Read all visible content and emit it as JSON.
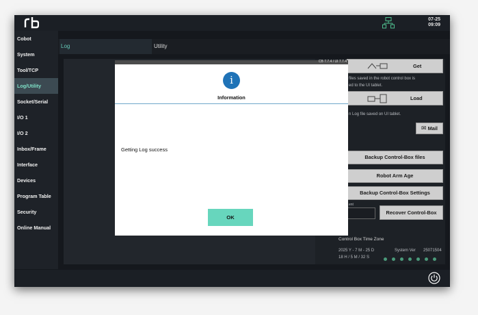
{
  "topbar": {
    "logo": "rb",
    "date": "07-25",
    "time": "09:09",
    "network_icon": "network-icon",
    "accent": "#4fbf8f"
  },
  "sidebar": {
    "items": [
      "Cobot",
      "System",
      "Tool/TCP",
      "Log/Utility",
      "Socket/Serial",
      "I/O 1",
      "I/O 2",
      "Inbox/Frame",
      "Interface",
      "Devices",
      "Program Table",
      "Security",
      "Online Manual"
    ],
    "active": "Log/Utility"
  },
  "tabs": {
    "log": "Log",
    "utility": "Utility"
  },
  "right_panel": {
    "get_label": "Get",
    "get_desc": [
      "files saved in the robot control box is",
      "ed to the UI tablet."
    ],
    "load_label": "Load",
    "load_desc": "n Log file saved on UI tablet.",
    "mail_label": "Mail",
    "backup_files": "Backup Control-Box files",
    "robot_arm_age": "Robot Arm Age",
    "backup_settings": "Backup Control-Box Settings",
    "input_label": "ent",
    "recover": "Recover Control-Box",
    "timezone_title": "Control Box Time Zone",
    "date_line": "2025 Y - 7 M - 25 D",
    "time_line": "18 H / 5 M / 32 S",
    "system_ver_label": "System Ver",
    "system_ver": "25071504"
  },
  "dialog": {
    "version": "CB 7.7.4 / UI 7.7.4",
    "icon": "info-icon",
    "title": "Information",
    "message": "Getting Log success",
    "ok": "OK"
  }
}
